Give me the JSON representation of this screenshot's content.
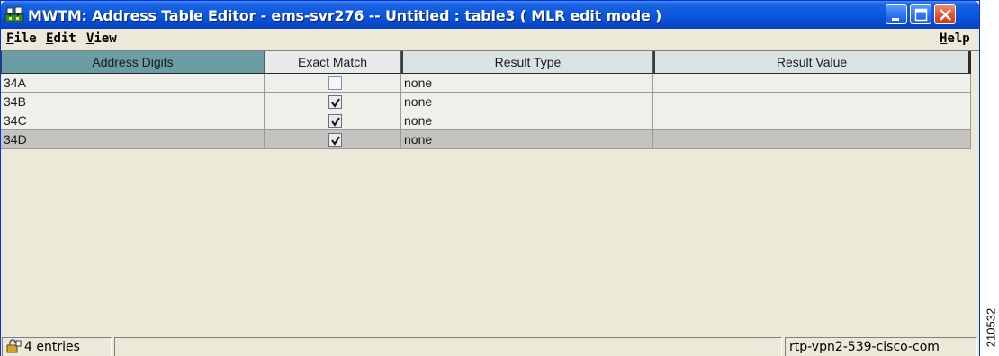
{
  "window": {
    "title": "MWTM:  Address Table Editor - ems-svr276 -- Untitled : table3 ( MLR  edit mode )",
    "controls": [
      "minimize-icon",
      "maximize-icon",
      "close-icon"
    ],
    "accent": "#0a58e0"
  },
  "menu": {
    "file_mn": "F",
    "file_rest": "ile",
    "edit_mn": "E",
    "edit_rest": "dit",
    "view_mn": "V",
    "view_rest": "iew",
    "help_mn": "H",
    "help_rest": "elp"
  },
  "table": {
    "columns": [
      "Address Digits",
      "Exact Match",
      "Result Type",
      "Result Value"
    ],
    "rows": [
      {
        "address": "34A",
        "exact_match": false,
        "result_type": "none",
        "result_value": ""
      },
      {
        "address": "34B",
        "exact_match": true,
        "result_type": "none",
        "result_value": ""
      },
      {
        "address": "34C",
        "exact_match": true,
        "result_type": "none",
        "result_value": ""
      },
      {
        "address": "34D",
        "exact_match": true,
        "result_type": "none",
        "result_value": "",
        "selected": true
      }
    ]
  },
  "status": {
    "entries": "4 entries",
    "host": "rtp-vpn2-539-cisco-com",
    "icon": "lock-icon"
  },
  "figure_id": "210532"
}
